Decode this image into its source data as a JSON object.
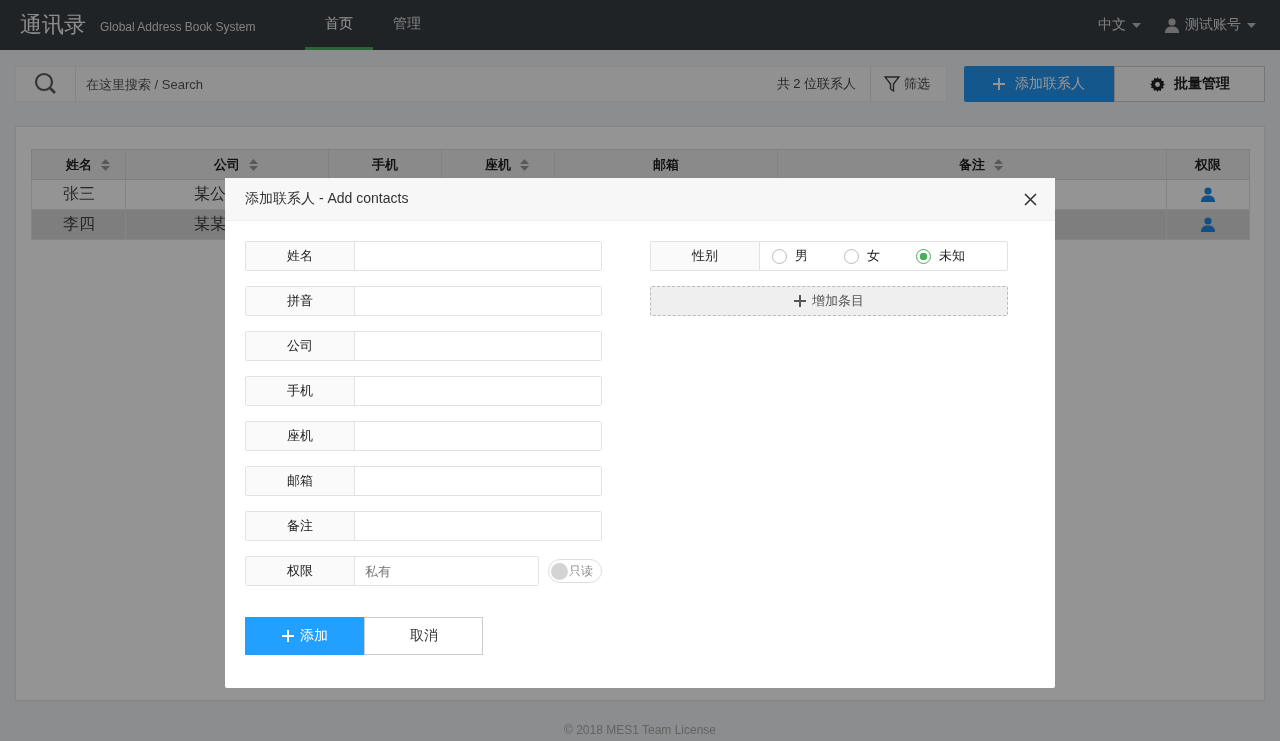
{
  "header": {
    "logo": "通讯录",
    "subtitle": "Global Address Book System",
    "nav": [
      {
        "label": "首页",
        "selected": true
      },
      {
        "label": "管理",
        "selected": false
      }
    ],
    "language": "中文",
    "account": "测试账号"
  },
  "toolbar": {
    "search_placeholder": "在这里搜索 / Search",
    "count": "共 2 位联系人",
    "filter": "筛选",
    "add_button": "添加联系人",
    "batch_button": "批量管理"
  },
  "table": {
    "columns": [
      {
        "label": "姓名",
        "sortable": true
      },
      {
        "label": "公司",
        "sortable": true
      },
      {
        "label": "手机",
        "sortable": false
      },
      {
        "label": "座机",
        "sortable": true
      },
      {
        "label": "邮箱",
        "sortable": false
      },
      {
        "label": "备注",
        "sortable": true
      },
      {
        "label": "权限",
        "sortable": false
      }
    ],
    "rows": [
      {
        "name": "张三",
        "company": "某公",
        "selected": false
      },
      {
        "name": "李四",
        "company": "某某",
        "selected": true
      }
    ]
  },
  "footer": "© 2018 MES1 Team License",
  "modal": {
    "title": "添加联系人 - Add contacts",
    "fields": [
      {
        "label": "姓名",
        "kind": "text"
      },
      {
        "label": "拼音",
        "kind": "text"
      },
      {
        "label": "公司",
        "kind": "text"
      },
      {
        "label": "手机",
        "kind": "text"
      },
      {
        "label": "座机",
        "kind": "text"
      },
      {
        "label": "邮箱",
        "kind": "text"
      },
      {
        "label": "备注",
        "kind": "text"
      },
      {
        "label": "权限",
        "kind": "permission",
        "placeholder": "私有",
        "toggle": {
          "label": "只读",
          "on": false
        }
      }
    ],
    "gender": {
      "label": "性别",
      "options": [
        {
          "label": "男",
          "selected": false
        },
        {
          "label": "女",
          "selected": false
        },
        {
          "label": "未知",
          "selected": true
        }
      ]
    },
    "add_item": "增加条目",
    "buttons": [
      {
        "label": "添加",
        "kind": "primary"
      },
      {
        "label": "取消",
        "kind": "default"
      }
    ]
  }
}
